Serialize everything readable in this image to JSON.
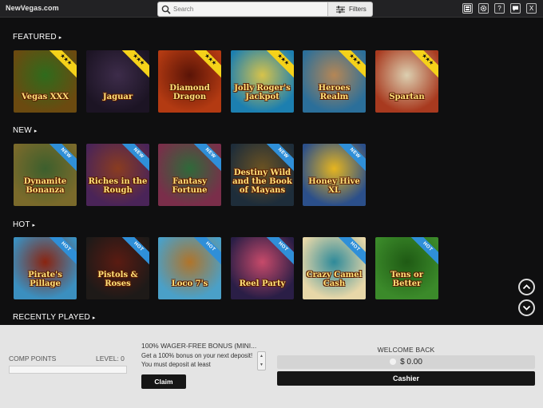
{
  "topbar": {
    "brand": "NewVegas.com",
    "search_placeholder": "Search",
    "filters_label": "Filters",
    "buttons": [
      {
        "icon": "chips-icon"
      },
      {
        "icon": "gear-icon"
      },
      {
        "icon": "help-icon",
        "label": "?"
      },
      {
        "icon": "chat-icon"
      },
      {
        "icon": "close-icon",
        "label": "X"
      }
    ]
  },
  "sections": {
    "featured": {
      "title": "FEATURED",
      "ribbon": "★★★"
    },
    "new": {
      "title": "NEW",
      "ribbon": "NEW"
    },
    "hot": {
      "title": "HOT",
      "ribbon": "HOT"
    },
    "recent": {
      "title": "RECENTLY PLAYED"
    }
  },
  "games": {
    "featured": [
      {
        "name": "Vegas XXX",
        "colors": [
          "#6b4a10",
          "#2f6b1c"
        ]
      },
      {
        "name": "Jaguar",
        "colors": [
          "#1c1424",
          "#3d2c4a"
        ]
      },
      {
        "name": "Diamond Dragon",
        "colors": [
          "#b33a12",
          "#5a1407"
        ]
      },
      {
        "name": "Jolly Roger's Jackpot",
        "colors": [
          "#1c7fb0",
          "#d7c34a"
        ]
      },
      {
        "name": "Heroes Realm",
        "colors": [
          "#2b6f9a",
          "#b58655"
        ]
      },
      {
        "name": "Spartan",
        "colors": [
          "#a83a1f",
          "#dccfb0"
        ]
      }
    ],
    "new": [
      {
        "name": "Dynamite Bonanza",
        "colors": [
          "#7a6a2b",
          "#3c5f2d"
        ]
      },
      {
        "name": "Riches in the Rough",
        "colors": [
          "#4a2458",
          "#8a3c20"
        ]
      },
      {
        "name": "Fantasy Fortune",
        "colors": [
          "#7a2e4a",
          "#2f6a3a"
        ]
      },
      {
        "name": "Destiny Wild and the Book of Mayans",
        "colors": [
          "#1e2d3a",
          "#6b5222"
        ]
      },
      {
        "name": "Honey Hive XL",
        "colors": [
          "#2b4f8a",
          "#e6b51f"
        ]
      }
    ],
    "hot": [
      {
        "name": "Pirate's Pillage",
        "colors": [
          "#3b8fbf",
          "#8a2410"
        ]
      },
      {
        "name": "Pistols & Roses",
        "colors": [
          "#1e1a18",
          "#5a1b12"
        ]
      },
      {
        "name": "Loco 7's",
        "colors": [
          "#4aa0c8",
          "#b0742a"
        ]
      },
      {
        "name": "Reel Party",
        "colors": [
          "#2a1e46",
          "#c74a6a"
        ]
      },
      {
        "name": "Crazy Camel Cash",
        "colors": [
          "#e7d7a8",
          "#2e8a9a"
        ]
      },
      {
        "name": "Tens or Better",
        "colors": [
          "#3b8a2a",
          "#1f5a14"
        ]
      }
    ]
  },
  "bottom": {
    "comp_points_label": "COMP POINTS",
    "level_label": "LEVEL: 0",
    "comp_progress": 0,
    "bonus_title": "100% WAGER-FREE BONUS (MINI...",
    "bonus_text": "Get a 100% bonus on your next deposit! You must deposit at least",
    "claim_label": "Claim",
    "welcome_label": "WELCOME BACK",
    "balance": "$ 0.00",
    "cashier_label": "Cashier"
  }
}
